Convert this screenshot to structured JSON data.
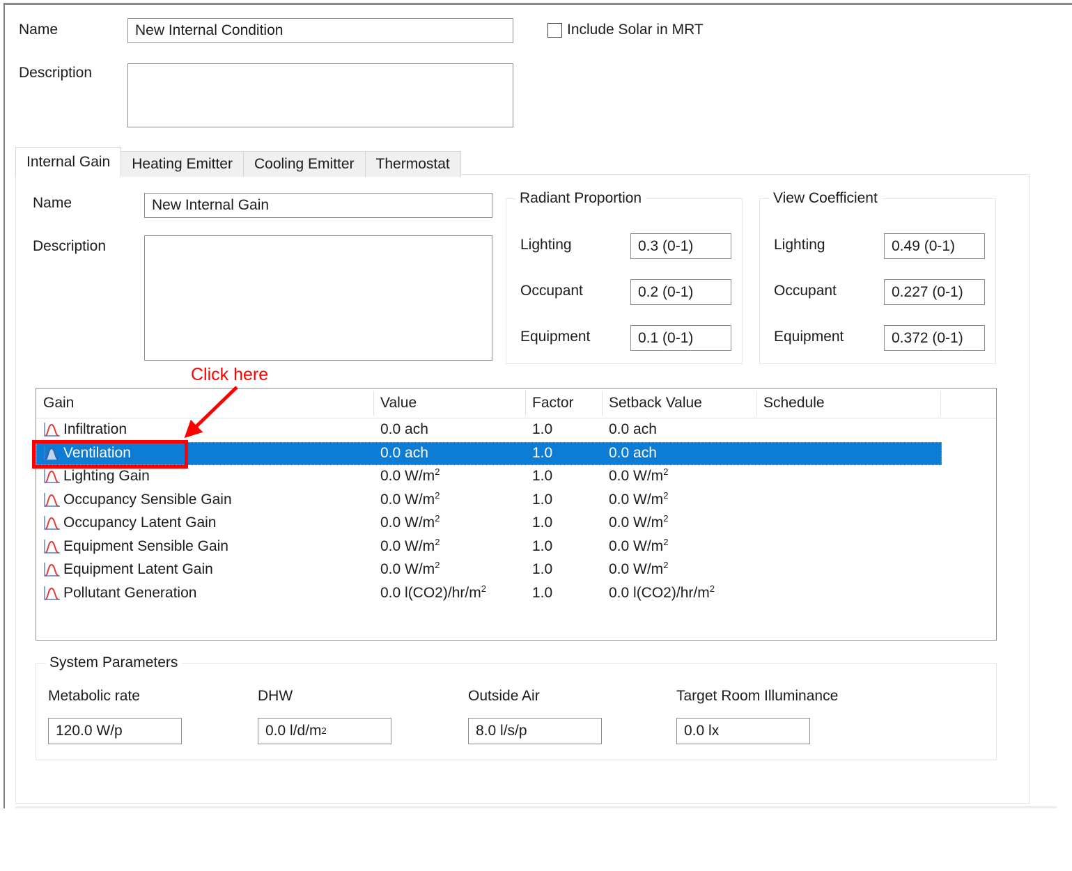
{
  "form": {
    "name_label": "Name",
    "name_value": "New Internal Condition",
    "description_label": "Description",
    "description_value": "",
    "include_solar": {
      "label": "Include Solar in MRT",
      "checked": false
    }
  },
  "tabs": [
    {
      "label": "Internal Gain",
      "active": true
    },
    {
      "label": "Heating Emitter",
      "active": false
    },
    {
      "label": "Cooling Emitter",
      "active": false
    },
    {
      "label": "Thermostat",
      "active": false
    }
  ],
  "internal_gain": {
    "name_label": "Name",
    "name_value": "New Internal Gain",
    "description_label": "Description",
    "description_value": ""
  },
  "radiant_proportion": {
    "title": "Radiant Proportion",
    "rows": [
      {
        "label": "Lighting",
        "value": "0.3 (0-1)"
      },
      {
        "label": "Occupant",
        "value": "0.2 (0-1)"
      },
      {
        "label": "Equipment",
        "value": "0.1 (0-1)"
      }
    ]
  },
  "view_coefficient": {
    "title": "View Coefficient",
    "rows": [
      {
        "label": "Lighting",
        "value": "0.49 (0-1)"
      },
      {
        "label": "Occupant",
        "value": "0.227 (0-1)"
      },
      {
        "label": "Equipment",
        "value": "0.372 (0-1)"
      }
    ]
  },
  "gain_table": {
    "columns": [
      "Gain",
      "Value",
      "Factor",
      "Setback Value",
      "Schedule"
    ],
    "rows": [
      {
        "gain": "Infiltration",
        "value": "0.0 ach",
        "value_sup": "",
        "factor": "1.0",
        "setback": "0.0 ach",
        "setback_sup": "",
        "schedule": "",
        "icon": "curve-red",
        "selected": false
      },
      {
        "gain": "Ventilation",
        "value": "0.0 ach",
        "value_sup": "",
        "factor": "1.0",
        "setback": "0.0 ach",
        "setback_sup": "",
        "schedule": "",
        "icon": "curve-blue",
        "selected": true
      },
      {
        "gain": "Lighting Gain",
        "value": "0.0 W/m",
        "value_sup": "2",
        "factor": "1.0",
        "setback": "0.0 W/m",
        "setback_sup": "2",
        "schedule": "",
        "icon": "curve-red",
        "selected": false
      },
      {
        "gain": "Occupancy Sensible Gain",
        "value": "0.0 W/m",
        "value_sup": "2",
        "factor": "1.0",
        "setback": "0.0 W/m",
        "setback_sup": "2",
        "schedule": "",
        "icon": "curve-red",
        "selected": false
      },
      {
        "gain": "Occupancy Latent Gain",
        "value": "0.0 W/m",
        "value_sup": "2",
        "factor": "1.0",
        "setback": "0.0 W/m",
        "setback_sup": "2",
        "schedule": "",
        "icon": "curve-red",
        "selected": false
      },
      {
        "gain": "Equipment Sensible Gain",
        "value": "0.0 W/m",
        "value_sup": "2",
        "factor": "1.0",
        "setback": "0.0 W/m",
        "setback_sup": "2",
        "schedule": "",
        "icon": "curve-red",
        "selected": false
      },
      {
        "gain": "Equipment Latent Gain",
        "value": "0.0 W/m",
        "value_sup": "2",
        "factor": "1.0",
        "setback": "0.0 W/m",
        "setback_sup": "2",
        "schedule": "",
        "icon": "curve-red",
        "selected": false
      },
      {
        "gain": "Pollutant Generation",
        "value": "0.0 l(CO2)/hr/m",
        "value_sup": "2",
        "factor": "1.0",
        "setback": "0.0 l(CO2)/hr/m",
        "setback_sup": "2",
        "schedule": "",
        "icon": "curve-red",
        "selected": false
      }
    ]
  },
  "system_parameters": {
    "title": "System Parameters",
    "fields": [
      {
        "label": "Metabolic rate",
        "value": "120.0 W/p"
      },
      {
        "label": "DHW",
        "value": "0.0 l/d/m",
        "sup": "2"
      },
      {
        "label": "Outside Air",
        "value": "8.0 l/s/p"
      },
      {
        "label": "Target Room Illuminance",
        "value": "0.0 lx"
      }
    ]
  },
  "annotation": {
    "text": "Click here",
    "color": "#ff0000"
  },
  "colors": {
    "selection_blue": "#0c7cd5",
    "annotation_red": "#ff0000",
    "icon_red": "#e23b3b",
    "icon_blue": "#3b5faa",
    "border_gray": "#888d91"
  }
}
